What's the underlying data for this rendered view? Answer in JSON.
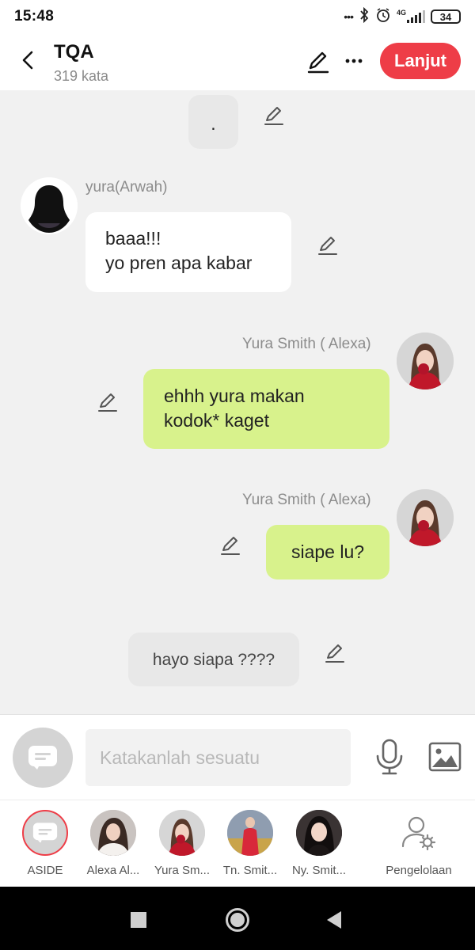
{
  "status": {
    "time": "15:48",
    "dots": "•••",
    "network": "4G",
    "battery": "34"
  },
  "header": {
    "title": "TQA",
    "subtitle": "319 kata",
    "next_label": "Lanjut"
  },
  "messages": [
    {
      "text": "."
    },
    {
      "sender": "yura(Arwah)",
      "lines": [
        "baaa!!!",
        "yo pren apa kabar"
      ]
    },
    {
      "sender": "Yura Smith ( Alexa)",
      "lines": [
        "ehhh yura makan",
        "kodok* kaget"
      ]
    },
    {
      "sender": "Yura Smith ( Alexa)",
      "text": "siape lu?"
    },
    {
      "text": "hayo siapa ????"
    }
  ],
  "input": {
    "placeholder": "Katakanlah sesuatu"
  },
  "characters": [
    {
      "label": "ASIDE"
    },
    {
      "label": "Alexa Al..."
    },
    {
      "label": "Yura Sm..."
    },
    {
      "label": "Tn. Smit..."
    },
    {
      "label": "Ny. Smit..."
    },
    {
      "label": "Pengelolaan"
    }
  ],
  "colors": {
    "accent": "#ee3d47",
    "my_bubble": "#d8f28c",
    "other_bubble": "#ffffff",
    "narration_bubble": "#e8e8e8"
  }
}
